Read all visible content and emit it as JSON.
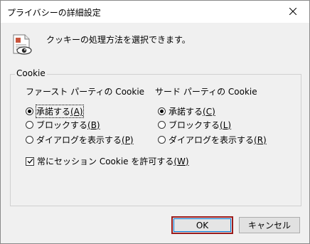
{
  "window": {
    "title": "プライバシーの詳細設定"
  },
  "header": {
    "text": "クッキーの処理方法を選択できます。"
  },
  "group": {
    "legend": "Cookie",
    "first_party": {
      "title": "ファースト パーティの Cookie",
      "options": [
        {
          "label": "承諾する",
          "key": "(A)",
          "selected": true
        },
        {
          "label": "ブロックする",
          "key": "(B)",
          "selected": false
        },
        {
          "label": "ダイアログを表示する",
          "key": "(P)",
          "selected": false
        }
      ]
    },
    "third_party": {
      "title": "サード パーティの Cookie",
      "options": [
        {
          "label": "承諾する",
          "key": "(C)",
          "selected": true
        },
        {
          "label": "ブロックする",
          "key": "(L)",
          "selected": false
        },
        {
          "label": "ダイアログを表示する",
          "key": "(R)",
          "selected": false
        }
      ]
    },
    "session_checkbox": {
      "label": "常にセッション Cookie を許可する",
      "key": "(W)",
      "checked": true
    }
  },
  "buttons": {
    "ok": "OK",
    "cancel": "キャンセル"
  },
  "icons": {
    "close": "close-icon",
    "privacy": "privacy-eye-document-icon"
  },
  "colors": {
    "ok_border": "#9b1c1c",
    "focus_blue": "#0078d7",
    "dialog_bg": "#f0f0f0"
  }
}
